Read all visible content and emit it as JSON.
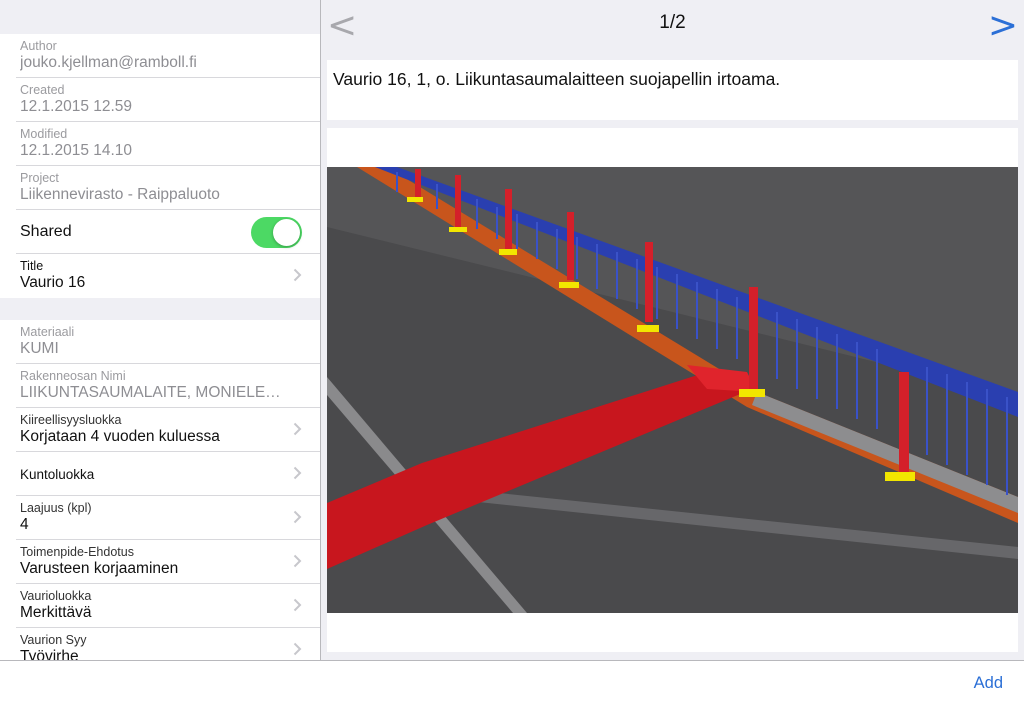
{
  "details": {
    "author_label": "Author",
    "author_value": "jouko.kjellman@ramboll.fi",
    "created_label": "Created",
    "created_value": "12.1.2015 12.59",
    "modified_label": "Modified",
    "modified_value": "12.1.2015 14.10",
    "project_label": "Project",
    "project_value": "Liikennevirasto - Raippaluoto",
    "shared_label": "Shared",
    "shared_on": true,
    "title_label": "Title",
    "title_value": "Vaurio 16"
  },
  "attributes": {
    "materiaali_label": "Materiaali",
    "materiaali_value": "KUMI",
    "rakenneosan_label": "Rakenneosan Nimi",
    "rakenneosan_value": "LIIKUNTASAUMALAITE, MONIELE…",
    "kiireellisyys_label": "Kiireellisyysluokka",
    "kiireellisyys_value": "Korjataan 4 vuoden kuluessa",
    "kunto_label": "Kuntoluokka",
    "laajuus_label": "Laajuus (kpl)",
    "laajuus_value": "4",
    "toimenpide_label": "Toimenpide-Ehdotus",
    "toimenpide_value": "Varusteen korjaaminen",
    "vaurioluokka_label": "Vaurioluokka",
    "vaurioluokka_value": "Merkittävä",
    "syy_label": "Vaurion Syy",
    "syy_value": "Työvirhe"
  },
  "viewer": {
    "prev_glyph": "<",
    "next_glyph": ">",
    "pager": "1/2",
    "description": "Vaurio 16, 1, o. Liikuntasaumalaitteen suojapellin irtoama."
  },
  "toolbar": {
    "add_label": "Add"
  },
  "colors": {
    "accent": "#2b6fd6",
    "toggle_on": "#4cd964",
    "railing_blue": "#2a3fb0",
    "post_red": "#d4202a",
    "deck_gray": "#4a4a4c",
    "joint_red": "#c8161e",
    "curb_orange": "#c8551c",
    "base_yellow": "#f2e600"
  }
}
